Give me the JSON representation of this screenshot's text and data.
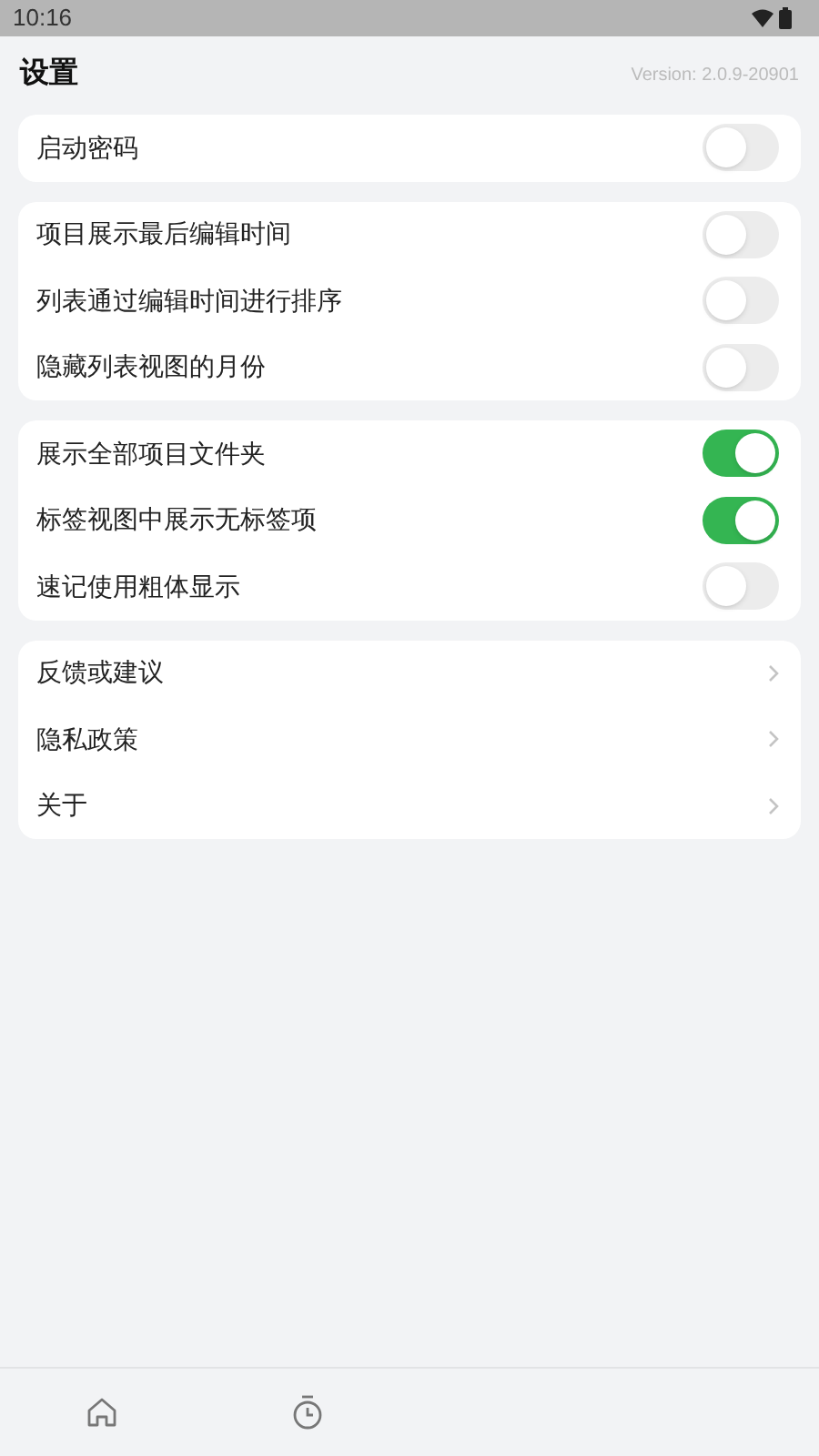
{
  "status_bar": {
    "time": "10:16"
  },
  "header": {
    "title": "设置",
    "version": "Version: 2.0.9-20901"
  },
  "groups": [
    {
      "items": [
        {
          "kind": "toggle",
          "label": "启动密码",
          "on": false
        }
      ]
    },
    {
      "items": [
        {
          "kind": "toggle",
          "label": "项目展示最后编辑时间",
          "on": false
        },
        {
          "kind": "toggle",
          "label": "列表通过编辑时间进行排序",
          "on": false
        },
        {
          "kind": "toggle",
          "label": "隐藏列表视图的月份",
          "on": false
        }
      ]
    },
    {
      "items": [
        {
          "kind": "toggle",
          "label": "展示全部项目文件夹",
          "on": true
        },
        {
          "kind": "toggle",
          "label": "标签视图中展示无标签项",
          "on": true
        },
        {
          "kind": "toggle",
          "label": "速记使用粗体显示",
          "on": false
        }
      ]
    },
    {
      "items": [
        {
          "kind": "link",
          "label": "反馈或建议"
        },
        {
          "kind": "link",
          "label": "隐私政策"
        },
        {
          "kind": "link",
          "label": "关于"
        }
      ]
    }
  ],
  "tab_bar": [
    {
      "kind": "home"
    },
    {
      "kind": "timer"
    }
  ]
}
